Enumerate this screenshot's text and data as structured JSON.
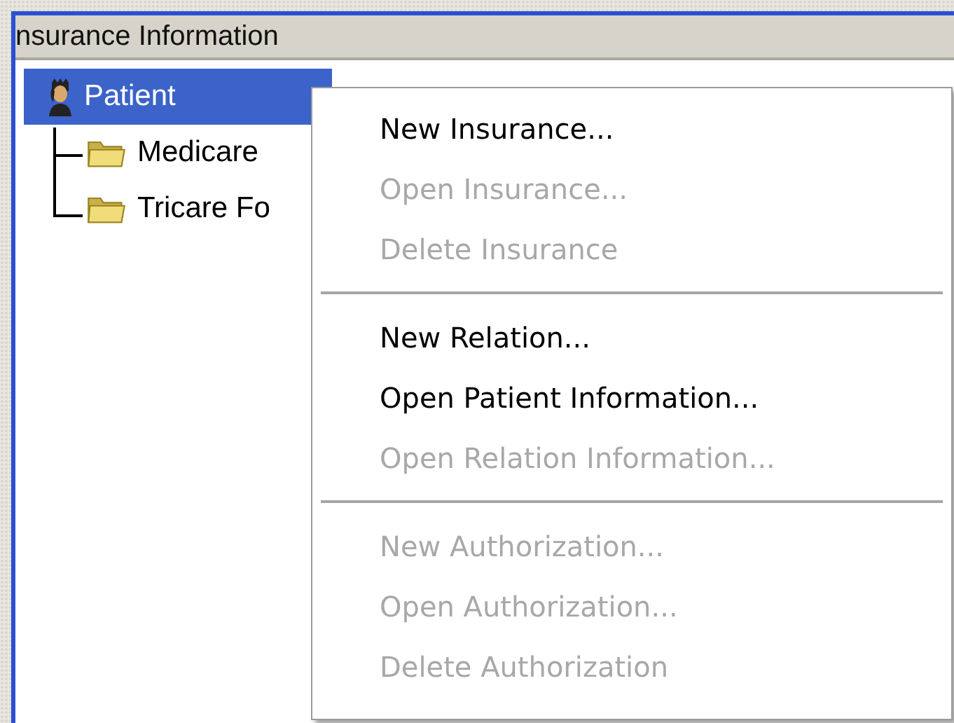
{
  "panel": {
    "title": "nsurance Information"
  },
  "tree": {
    "label": "Patient",
    "selected": true,
    "children": [
      {
        "label": "Medicare",
        "selected": false
      },
      {
        "label": "Tricare Fo",
        "selected": false
      }
    ]
  },
  "context_menu": [
    {
      "kind": "item",
      "label": "New Insurance...",
      "disabled": false
    },
    {
      "kind": "item",
      "label": "Open Insurance...",
      "disabled": true
    },
    {
      "kind": "item",
      "label": "Delete Insurance",
      "disabled": true
    },
    {
      "kind": "separator"
    },
    {
      "kind": "item",
      "label": "New Relation...",
      "disabled": false
    },
    {
      "kind": "item",
      "label": "Open Patient Information...",
      "disabled": false
    },
    {
      "kind": "item",
      "label": "Open Relation Information...",
      "disabled": true
    },
    {
      "kind": "separator"
    },
    {
      "kind": "item",
      "label": "New Authorization...",
      "disabled": true
    },
    {
      "kind": "item",
      "label": "Open Authorization...",
      "disabled": true
    },
    {
      "kind": "item",
      "label": "Delete Authorization",
      "disabled": true
    }
  ]
}
